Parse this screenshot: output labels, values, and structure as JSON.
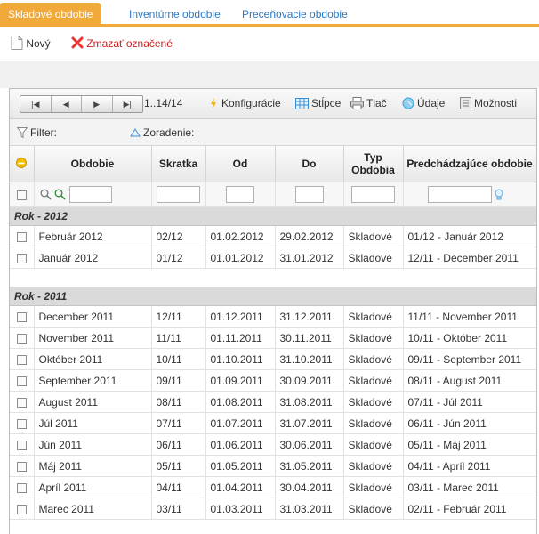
{
  "tabs": [
    "Skladové obdobie",
    "Inventúrne obdobie",
    "Preceňovacie obdobie"
  ],
  "toolbar": {
    "new_label": "Nový",
    "delete_label": "Zmazať označené"
  },
  "pager": {
    "buttons": [
      "|◀",
      "◀",
      "▶",
      "▶|"
    ],
    "range": "1..14/14",
    "tools": [
      "Konfigurácie",
      "Stĺpce",
      "Tlač",
      "Údaje",
      "Možnosti"
    ]
  },
  "filterbar": {
    "filter_label": "Filter:",
    "sort_label": "Zoradenie:"
  },
  "columns": [
    "Obdobie",
    "Skratka",
    "Od",
    "Do",
    "Typ Obdobia",
    "Predchádzajúce obdobie"
  ],
  "groups": [
    {
      "label": "Rok - 2012",
      "rows": [
        [
          "Február 2012",
          "02/12",
          "01.02.2012",
          "29.02.2012",
          "Skladové",
          "01/12 - Január 2012"
        ],
        [
          "Január 2012",
          "01/12",
          "01.01.2012",
          "31.01.2012",
          "Skladové",
          "12/11 - December 2011"
        ]
      ]
    },
    {
      "label": "Rok - 2011",
      "rows": [
        [
          "December 2011",
          "12/11",
          "01.12.2011",
          "31.12.2011",
          "Skladové",
          "11/11 - November 2011"
        ],
        [
          "November 2011",
          "11/11",
          "01.11.2011",
          "30.11.2011",
          "Skladové",
          "10/11 - Október 2011"
        ],
        [
          "Október 2011",
          "10/11",
          "01.10.2011",
          "31.10.2011",
          "Skladové",
          "09/11 - September 2011"
        ],
        [
          "September 2011",
          "09/11",
          "01.09.2011",
          "30.09.2011",
          "Skladové",
          "08/11 - August 2011"
        ],
        [
          "August 2011",
          "08/11",
          "01.08.2011",
          "31.08.2011",
          "Skladové",
          "07/11 - Júl 2011"
        ],
        [
          "Júl 2011",
          "07/11",
          "01.07.2011",
          "31.07.2011",
          "Skladové",
          "06/11 - Jún 2011"
        ],
        [
          "Jún 2011",
          "06/11",
          "01.06.2011",
          "30.06.2011",
          "Skladové",
          "05/11 - Máj 2011"
        ],
        [
          "Máj 2011",
          "05/11",
          "01.05.2011",
          "31.05.2011",
          "Skladové",
          "04/11 - Apríl 2011"
        ],
        [
          "Apríl 2011",
          "04/11",
          "01.04.2011",
          "30.04.2011",
          "Skladové",
          "03/11 - Marec 2011"
        ],
        [
          "Marec 2011",
          "03/11",
          "01.03.2011",
          "31.03.2011",
          "Skladové",
          "02/11 - Február 2011"
        ]
      ]
    }
  ],
  "colors": {
    "accent": "#f1a93a",
    "link": "#2a78c4",
    "delete": "#d12020"
  }
}
